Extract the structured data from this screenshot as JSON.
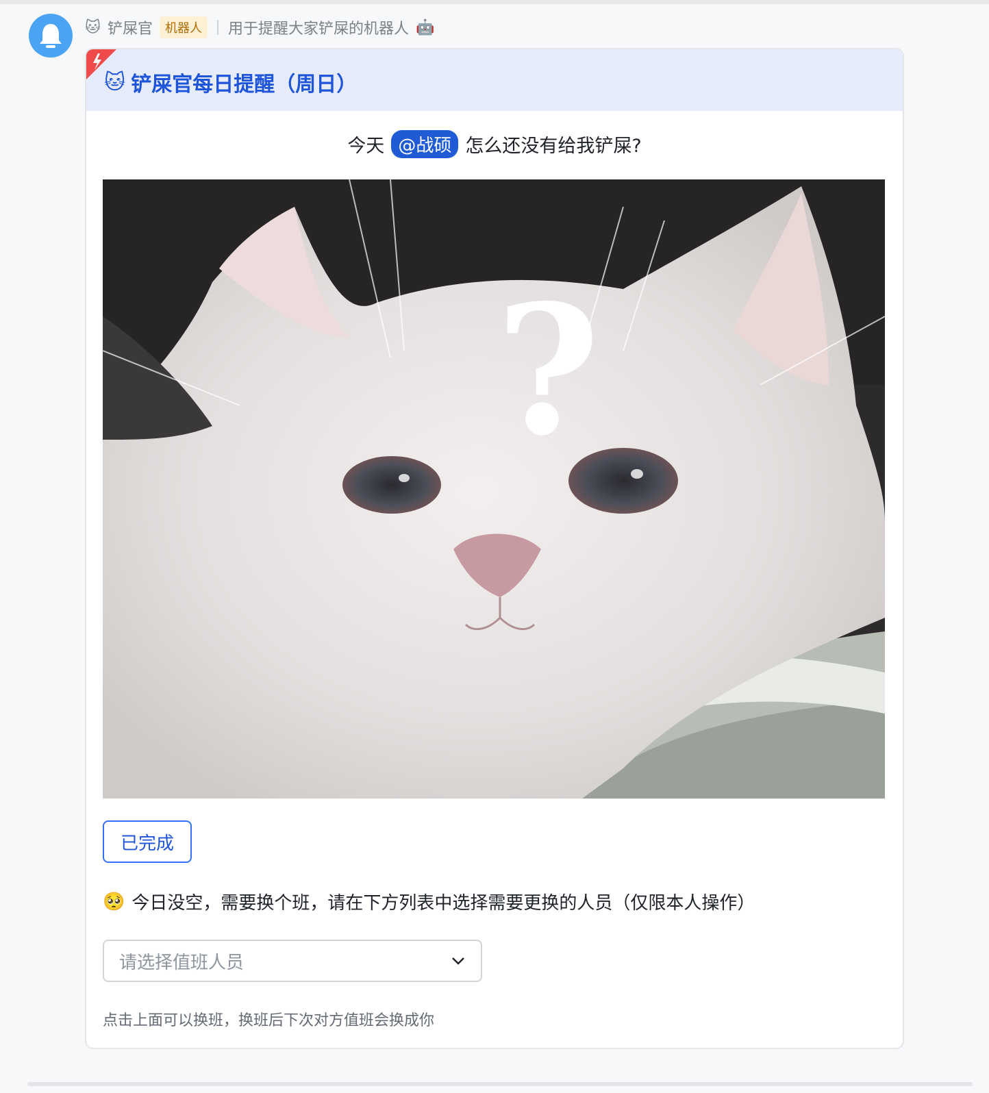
{
  "header": {
    "bot_emoji": "🐱",
    "bot_name": "铲屎官",
    "badge": "机器人",
    "description": "用于提醒大家铲屎的机器人",
    "description_emoji": "🤖"
  },
  "card": {
    "title_emoji": "🐱",
    "title": "铲屎官每日提醒（周日）",
    "remind_prefix": "今天",
    "mention": "@战硕",
    "remind_suffix": "怎么还没有给我铲屎?",
    "image_text": "?",
    "done_button": "已完成",
    "note_emoji": "🥺",
    "note": "今日没空，需要换个班，请在下方列表中选择需要更换的人员（仅限本人操作）",
    "select_placeholder": "请选择值班人员",
    "hint": "点击上面可以换班，换班后下次对方值班会换成你"
  },
  "colors": {
    "accent": "#1f56d9",
    "button_border": "#3370ff",
    "card_header_bg": "#e6ecfc",
    "avatar_bg": "#4aa3f5",
    "badge_bg": "#fdf0d5",
    "badge_text": "#b26b00"
  },
  "icons": [
    "bell-icon",
    "cat-emoji-icon",
    "robot-emoji-icon",
    "lightning-corner-icon",
    "pleading-face-icon",
    "chevron-down-icon"
  ]
}
